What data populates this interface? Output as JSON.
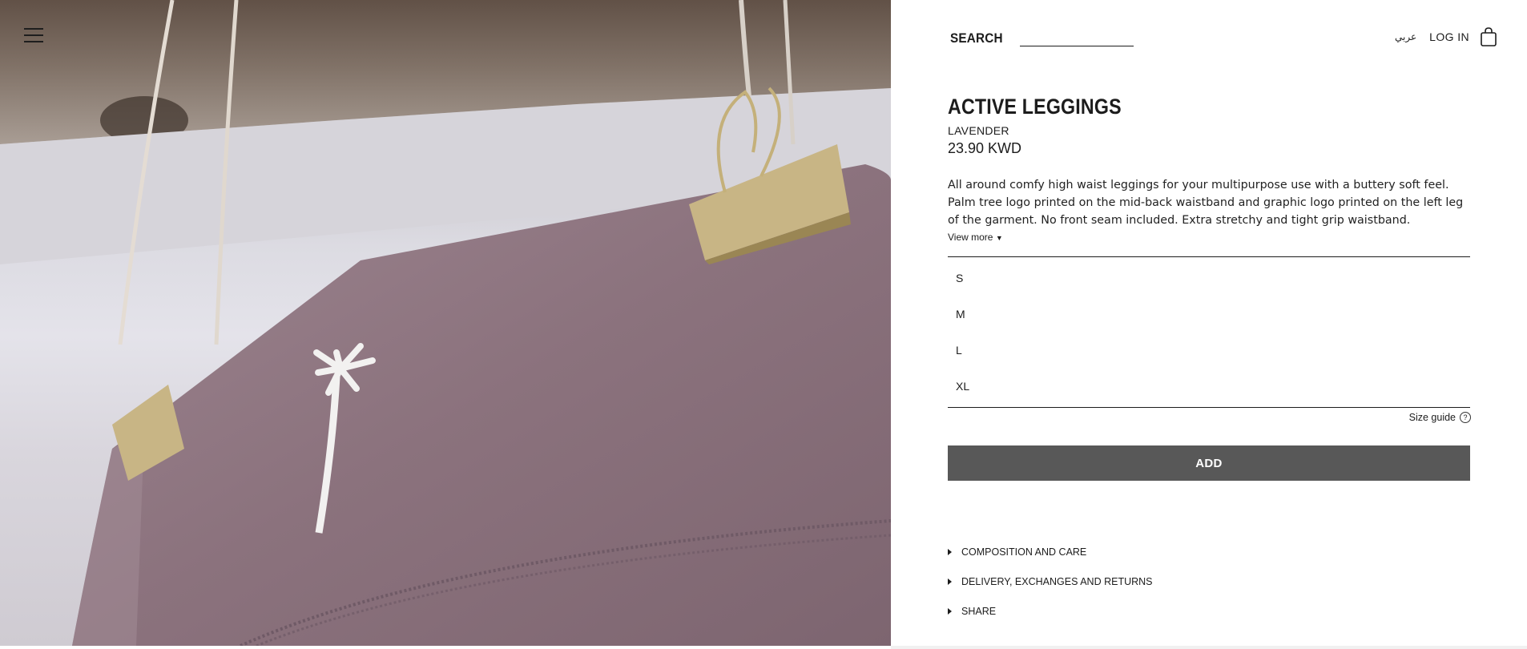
{
  "nav": {
    "menu_icon": "hamburger-menu-icon"
  },
  "header": {
    "search_label": "SEARCH",
    "search_value": "",
    "language_label": "عربي",
    "login_label": "LOG IN",
    "bag_icon": "shopping-bag-icon"
  },
  "product": {
    "title": "ACTIVE LEGGINGS",
    "color": "LAVENDER",
    "price": "23.90 KWD",
    "description": "All around comfy high waist leggings for your multipurpose use with a buttery soft feel. Palm tree logo printed on the mid-back waistband and graphic logo printed on the left leg of the garment. No front seam included. Extra stretchy and tight grip waistband.",
    "view_more_label": "View more",
    "sizes": [
      "S",
      "M",
      "L",
      "XL"
    ],
    "size_guide_label": "Size guide",
    "add_label": "ADD",
    "accordions": [
      "COMPOSITION AND CARE",
      "DELIVERY, EXCHANGES AND RETURNS",
      "SHARE"
    ]
  },
  "colors": {
    "add_button_bg": "#585858",
    "fabric": "#8e7580"
  }
}
